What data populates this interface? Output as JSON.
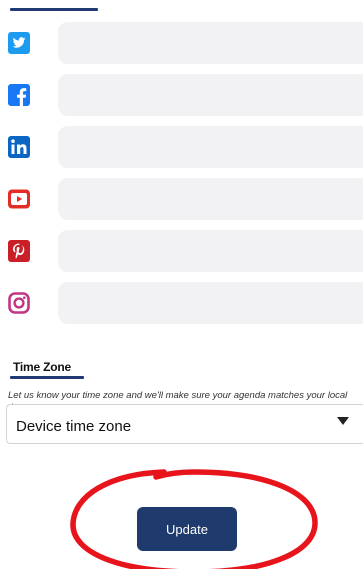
{
  "social_links": [
    {
      "id": "twitter",
      "icon": "twitter-icon",
      "color": "#1d9bf0",
      "value": "",
      "placeholder": ""
    },
    {
      "id": "facebook",
      "icon": "facebook-icon",
      "color": "#1877f2",
      "value": "",
      "placeholder": ""
    },
    {
      "id": "linkedin",
      "icon": "linkedin-icon",
      "color": "#0a66c2",
      "value": "",
      "placeholder": ""
    },
    {
      "id": "youtube",
      "icon": "youtube-icon",
      "color": "#e52d27",
      "value": "",
      "placeholder": ""
    },
    {
      "id": "pinterest",
      "icon": "pinterest-icon",
      "color": "#cb1f27",
      "value": "",
      "placeholder": ""
    },
    {
      "id": "instagram",
      "icon": "instagram-icon",
      "color": "#c13584",
      "value": "",
      "placeholder": ""
    }
  ],
  "time_zone": {
    "heading": "Time Zone",
    "help_text": "Let us know your time zone and we'll make sure your agenda matches your local time.",
    "selected": "Device time zone"
  },
  "update_button": {
    "label": "Update",
    "color": "#1f3a6d"
  },
  "annotation_color": "#e8141b",
  "accent_color": "#1f3a75"
}
